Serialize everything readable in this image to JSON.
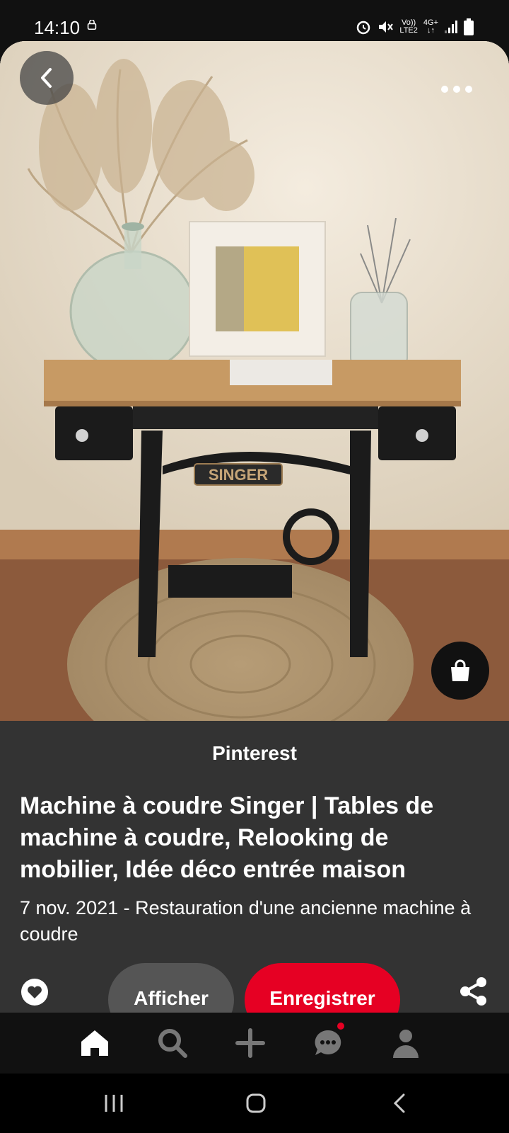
{
  "status_bar": {
    "time": "14:10",
    "network_top": "Vo))",
    "network_bottom": "LTE2",
    "signal_top": "4G+",
    "signal_bottom": "↓↑"
  },
  "pin": {
    "image_description_icons": [
      "back-icon",
      "more-icon",
      "shopping-bag-icon"
    ],
    "brand_plate_text": "SINGER"
  },
  "sheet": {
    "source": "Pinterest",
    "title": "Machine à coudre Singer | Tables de machine à coudre, Relooking de mobilier, Idée déco entrée maison",
    "description": "7 nov. 2021 - Restauration d'une ancienne machine à coudre",
    "view_button": "Afficher",
    "save_button": "Enregistrer"
  },
  "colors": {
    "save_red": "#e60023",
    "sheet_bg": "#333333",
    "nav_bg": "#111111"
  }
}
